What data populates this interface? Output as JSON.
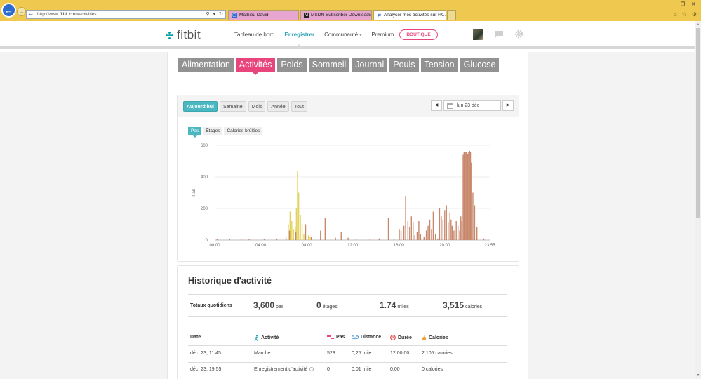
{
  "browser": {
    "url_prefix": "http://www.",
    "url_host": "fitbit.com",
    "url_path": "/activities",
    "tabs": [
      {
        "label": "Mathieu David"
      },
      {
        "label": "MSDN Subscriber Downloads"
      },
      {
        "label": "Analyser mes activités sur Fi..."
      }
    ]
  },
  "header": {
    "logo": "fitbit",
    "nav": [
      "Tableau de bord",
      "Enregistrer",
      "Communauté",
      "Premium"
    ],
    "shop_label": "BOUTIQUE"
  },
  "categories": [
    "Alimentation",
    "Activités",
    "Poids",
    "Sommeil",
    "Journal",
    "Pouls",
    "Tension",
    "Glucose"
  ],
  "periods": [
    "Aujourd'hui",
    "Semaine",
    "Mois",
    "Année",
    "Tout"
  ],
  "date_label": "lun 23 déc",
  "metric_tabs": [
    "Pas",
    "Étages",
    "Calories brûlées"
  ],
  "chart_data": {
    "type": "bar",
    "ylabel": "Pas",
    "ylim": [
      0,
      600
    ],
    "y_ticks": [
      "0",
      "200",
      "400",
      "600"
    ],
    "x_ticks": [
      "00:00",
      "04:00",
      "08:00",
      "12:00",
      "16:00",
      "20:00",
      "23:55"
    ],
    "series": [
      {
        "color": "#e3d25f",
        "points": [
          [
            6.4,
            100
          ],
          [
            6.55,
            180
          ],
          [
            6.7,
            120
          ],
          [
            6.85,
            70
          ],
          [
            7.0,
            85
          ],
          [
            7.1,
            200
          ],
          [
            7.2,
            440
          ],
          [
            7.3,
            300
          ],
          [
            7.45,
            160
          ],
          [
            7.6,
            100
          ],
          [
            7.75,
            40
          ],
          [
            8.15,
            30
          ],
          [
            8.3,
            20
          ]
        ]
      },
      {
        "color": "#c8876b",
        "points": [
          [
            0.2,
            5
          ],
          [
            1.3,
            5
          ],
          [
            2.3,
            5
          ],
          [
            3.0,
            5
          ],
          [
            4.3,
            5
          ],
          [
            5.4,
            5
          ],
          [
            6.2,
            15
          ],
          [
            6.5,
            60
          ],
          [
            7.05,
            50
          ],
          [
            7.9,
            100
          ],
          [
            8.4,
            20
          ],
          [
            9.2,
            60
          ],
          [
            9.6,
            140
          ],
          [
            10.5,
            15
          ],
          [
            11.0,
            50
          ],
          [
            11.6,
            15
          ],
          [
            12.3,
            5
          ],
          [
            13.5,
            5
          ],
          [
            14.3,
            10
          ],
          [
            15.1,
            140
          ],
          [
            15.6,
            5
          ],
          [
            16.05,
            70
          ],
          [
            16.2,
            60
          ],
          [
            16.45,
            90
          ],
          [
            16.6,
            280
          ],
          [
            16.8,
            120
          ],
          [
            16.95,
            80
          ],
          [
            17.1,
            150
          ],
          [
            17.25,
            110
          ],
          [
            17.4,
            30
          ],
          [
            17.6,
            50
          ],
          [
            17.75,
            120
          ],
          [
            17.9,
            40
          ],
          [
            18.2,
            20
          ],
          [
            18.4,
            60
          ],
          [
            18.55,
            90
          ],
          [
            18.7,
            130
          ],
          [
            18.85,
            70
          ],
          [
            19.0,
            180
          ],
          [
            19.2,
            40
          ],
          [
            19.4,
            10
          ],
          [
            19.55,
            200
          ],
          [
            19.7,
            150
          ],
          [
            19.85,
            130
          ],
          [
            20.0,
            190
          ],
          [
            20.15,
            220
          ],
          [
            20.3,
            110
          ],
          [
            20.45,
            175
          ],
          [
            20.55,
            130
          ],
          [
            20.65,
            90
          ],
          [
            20.8,
            60
          ],
          [
            21.0,
            120
          ],
          [
            21.15,
            90
          ],
          [
            21.3,
            60
          ],
          [
            21.4,
            150
          ],
          [
            21.5,
            120
          ],
          [
            21.6,
            540
          ],
          [
            21.68,
            560
          ],
          [
            21.76,
            555
          ],
          [
            21.84,
            560
          ],
          [
            21.92,
            560
          ],
          [
            22.0,
            545
          ],
          [
            22.08,
            560
          ],
          [
            22.16,
            565
          ],
          [
            22.24,
            560
          ],
          [
            22.32,
            490
          ],
          [
            22.45,
            300
          ],
          [
            22.6,
            220
          ],
          [
            22.8,
            80
          ],
          [
            23.4,
            10
          ]
        ]
      }
    ]
  },
  "history": {
    "title": "Historique d'activité",
    "totals_label": "Totaux quotidiens",
    "totals": [
      {
        "value": "3,600",
        "unit": "pas"
      },
      {
        "value": "0",
        "unit": "étages"
      },
      {
        "value": "1.74",
        "unit": "miles"
      },
      {
        "value": "3,515",
        "unit": "calories"
      }
    ],
    "columns": [
      "Date",
      "Activité",
      "Pas",
      "Distance",
      "Durée",
      "Calories"
    ],
    "rows": [
      {
        "date": "déc. 23, 11:45",
        "activity": "Marche",
        "steps": "523",
        "distance": "0,25 mile",
        "duration": "12:00:00",
        "calories": "2,105 calories"
      },
      {
        "date": "déc. 23, 19:55",
        "activity": "Enregistrement d'activité",
        "steps": "0",
        "distance": "0,01 mile",
        "duration": "0:00",
        "calories": "0 calories"
      }
    ]
  }
}
